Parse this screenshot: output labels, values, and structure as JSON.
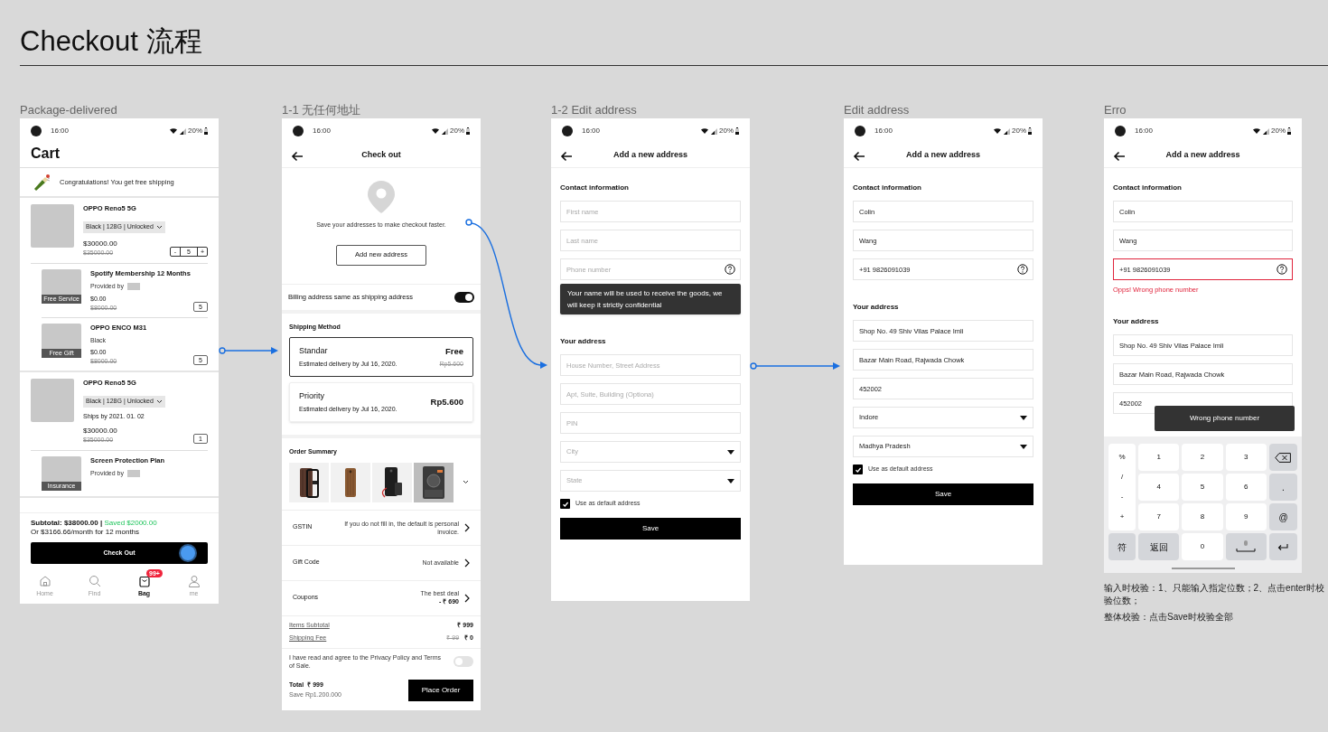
{
  "page_title": "Checkout 流程",
  "frames": [
    {
      "kind": "cart",
      "label": "Package-delivered",
      "status": {
        "time": "16:00",
        "battery": "20%"
      },
      "title": "Cart",
      "banner": "Congratulations! You get free shipping",
      "groups": [
        {
          "items": [
            {
              "kind": "product",
              "name": "OPPO Reno5 5G",
              "variant": "Black | 128G | Unlocked",
              "price": "$30000.00",
              "old_price": "$35000.00",
              "stepper": {
                "minus": "-",
                "value": "5",
                "plus": "+"
              }
            },
            {
              "kind": "addon",
              "tag": "Free Service",
              "name": "Spotify Membership 12 Months",
              "detail": "Provided by",
              "provider_logo": true,
              "price": "$0.00",
              "old_price": "$8000.00",
              "qty": "5"
            },
            {
              "kind": "addon",
              "tag": "Free Gift",
              "name": "OPPO ENCO M31",
              "detail": "Black",
              "price": "$0.00",
              "old_price": "$8000.00",
              "qty": "5"
            }
          ]
        },
        {
          "items": [
            {
              "kind": "product",
              "name": "OPPO Reno5 5G",
              "variant": "Black | 128G | Unlocked",
              "ships": "Ships by 2021. 01. 02",
              "price": "$30000.00",
              "old_price": "$35000.00",
              "qty": "1"
            },
            {
              "kind": "addon",
              "tag": "Insurance",
              "name": "Screen Protection Plan",
              "detail": "Provided by",
              "provider_logo": true
            }
          ]
        }
      ],
      "summary": {
        "subtotal": "Subtotal: $38000.00 |",
        "saved": "Saved $2000.00",
        "monthly": "Or $3166.66/month for 12 months"
      },
      "checkout_button": "Check Out",
      "nav": [
        {
          "label": "Home",
          "selected": false
        },
        {
          "label": "Find",
          "selected": false
        },
        {
          "label": "Bag",
          "badge": "99+",
          "selected": true
        },
        {
          "label": "me",
          "selected": false
        }
      ]
    },
    {
      "kind": "checkout",
      "label": "1-1 无任何地址",
      "status": {
        "time": "16:00",
        "battery": "20%"
      },
      "title": "Check out",
      "empty_address": {
        "message": "Save your addresses to make checkout faster.",
        "button": "Add new address"
      },
      "billing_toggle": {
        "label": "Billing address same as shipping address",
        "on": true
      },
      "shipping": {
        "heading": "Shipping Method",
        "options": [
          {
            "name": "Standar",
            "eta": "Estimated delivery by Jul 16, 2020.",
            "price": "Free",
            "old_price": "Rp5.600",
            "selected": true
          },
          {
            "name": "Priority",
            "eta": "Estimated delivery by Jul 16, 2020.",
            "price": "Rp5.600",
            "selected": false
          }
        ]
      },
      "order_summary": {
        "heading": "Order Summary",
        "products": [
          {
            "kind": "picture",
            "selected": false
          },
          {
            "kind": "picture",
            "selected": false
          },
          {
            "kind": "picture",
            "selected": false
          },
          {
            "kind": "picture",
            "selected": true
          }
        ]
      },
      "rows": [
        {
          "label": "GSTIN",
          "value": "If you do not fill in, the default is personal invoice."
        },
        {
          "label": "Gift Code",
          "value": "Not available"
        },
        {
          "label": "Coupons",
          "value": "The best deal",
          "value_2": "- ₹ 690"
        }
      ],
      "totals": [
        {
          "label": "Items Subtotal",
          "value": "₹ 999"
        },
        {
          "label": "Shipping Fee",
          "old_value": "₹ 99",
          "value": "₹ 0"
        }
      ],
      "agreement": {
        "text": "I have read and agree to the Privacy Policy and Terms of Sale.",
        "on": false
      },
      "footer": {
        "total_label": "Total",
        "total": "₹ 999",
        "save": "Save Rp1.200.000",
        "button": "Place Order"
      }
    },
    {
      "kind": "form",
      "label": "1-2 Edit address",
      "status": {
        "time": "16:00",
        "battery": "20%"
      },
      "title": "Add a new address",
      "sections": [
        {
          "heading": "Contact information",
          "fields": [
            {
              "kind": "text",
              "placeholder": "First name"
            },
            {
              "kind": "text",
              "placeholder": "Last name"
            },
            {
              "kind": "text",
              "placeholder": "Phone number",
              "help": true,
              "tooltip": "Your name will be used to receive the goods, we will keep it strictly confidential"
            }
          ]
        },
        {
          "heading": "Your address",
          "fields": [
            {
              "kind": "text",
              "placeholder": "House Number, Street Address"
            },
            {
              "kind": "text",
              "placeholder": "Apt, Suite, Building (Optiona)"
            },
            {
              "kind": "text",
              "placeholder": "PIN"
            },
            {
              "kind": "dropdown",
              "placeholder": "City"
            },
            {
              "kind": "dropdown",
              "placeholder": "State"
            }
          ]
        }
      ],
      "default_checkbox": {
        "label": "Use as default address",
        "checked": true
      },
      "save_button": "Save"
    },
    {
      "kind": "form",
      "label": "Edit address",
      "status": {
        "time": "16:00",
        "battery": "20%"
      },
      "title": "Add a new address",
      "sections": [
        {
          "heading": "Contact information",
          "fields": [
            {
              "kind": "text",
              "value": "Colin"
            },
            {
              "kind": "text",
              "value": "Wang"
            },
            {
              "kind": "text",
              "value": "+91 9826091039",
              "help": true
            }
          ]
        },
        {
          "heading": "Your address",
          "fields": [
            {
              "kind": "text",
              "value": "Shop No. 49 Shiv Vilas Palace Imli"
            },
            {
              "kind": "text",
              "value": "Bazar Main Road, Rajwada Chowk"
            },
            {
              "kind": "text",
              "value": "452002"
            },
            {
              "kind": "dropdown",
              "value": "Indore"
            },
            {
              "kind": "dropdown",
              "value": "Madhya Pradesh"
            }
          ]
        }
      ],
      "default_checkbox": {
        "label": "Use as default address",
        "checked": true
      },
      "save_button": "Save"
    },
    {
      "kind": "form",
      "label": "Erro",
      "status": {
        "time": "16:00",
        "battery": "20%"
      },
      "title": "Add a new address",
      "sections": [
        {
          "heading": "Contact information",
          "fields": [
            {
              "kind": "text",
              "value": "Colin"
            },
            {
              "kind": "text",
              "value": "Wang"
            },
            {
              "kind": "text",
              "value": "+91 9826091039",
              "help": true,
              "error_text": "Opps! Wrong phone number"
            }
          ]
        },
        {
          "heading": "Your address",
          "fields": [
            {
              "kind": "text",
              "value": "Shop No. 49 Shiv Vilas Palace Imli"
            },
            {
              "kind": "text",
              "value": "Bazar Main Road, Rajwada Chowk"
            },
            {
              "kind": "text",
              "value": "452002"
            }
          ]
        }
      ],
      "toast": "Wrong phone number",
      "keyboard": {
        "symbols": [
          "%",
          "/",
          "-",
          "+"
        ],
        "digits": [
          [
            "1",
            "2",
            "3"
          ],
          [
            "4",
            "5",
            "6"
          ],
          [
            "7",
            "8",
            "9"
          ]
        ],
        "side_keys": [
          {
            "kind": "backspace"
          },
          {
            "kind": "char",
            "label": "."
          },
          {
            "kind": "char",
            "label": "@"
          }
        ],
        "bottom_keys": [
          {
            "kind": "char",
            "label": "符"
          },
          {
            "kind": "char",
            "label": "返回"
          },
          {
            "kind": "digit",
            "label": "0"
          },
          {
            "kind": "space"
          },
          {
            "kind": "enter"
          }
        ]
      },
      "notes": [
        "输入时校验：1、只能输入指定位数；2、点击enter时校验位数；",
        "整体校验：点击Save时校验全部"
      ]
    }
  ]
}
